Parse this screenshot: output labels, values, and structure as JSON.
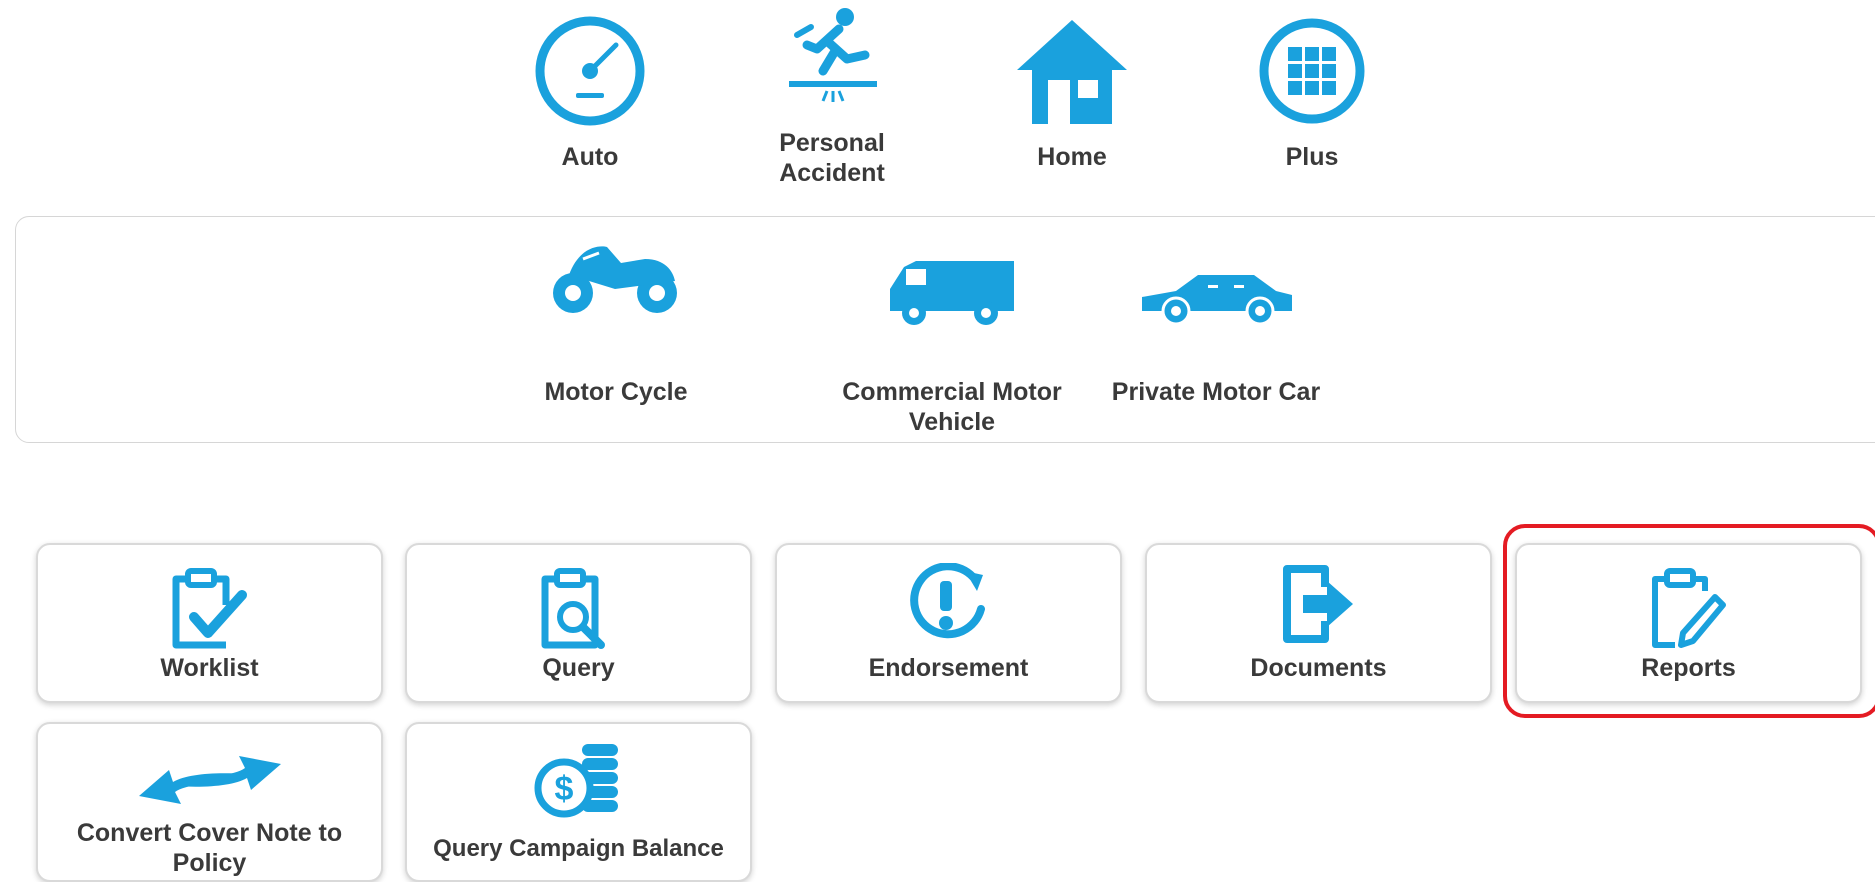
{
  "accent_color": "#1aa1dd",
  "highlight_color": "#e41b23",
  "categories": [
    {
      "label": "Auto",
      "icon": "speedometer-icon"
    },
    {
      "label": "Personal\nAccident",
      "icon": "falling-person-icon"
    },
    {
      "label": "Home",
      "icon": "house-icon"
    },
    {
      "label": "Plus",
      "icon": "grid-icon"
    }
  ],
  "auto_products": [
    {
      "label": "Motor Cycle",
      "icon": "motorcycle-icon"
    },
    {
      "label": "Commercial Motor\nVehicle",
      "icon": "van-icon"
    },
    {
      "label": "Private Motor Car",
      "icon": "car-icon"
    }
  ],
  "tiles": [
    {
      "label": "Worklist",
      "icon": "clipboard-check-icon"
    },
    {
      "label": "Query",
      "icon": "clipboard-search-icon"
    },
    {
      "label": "Endorsement",
      "icon": "exclamation-refresh-icon"
    },
    {
      "label": "Documents",
      "icon": "document-arrow-icon"
    },
    {
      "label": "Reports",
      "icon": "clipboard-pencil-icon",
      "highlighted": true
    },
    {
      "label": "Convert Cover Note to\nPolicy",
      "icon": "swap-arrows-icon"
    },
    {
      "label": "Query Campaign Balance",
      "icon": "coin-stack-icon"
    }
  ]
}
